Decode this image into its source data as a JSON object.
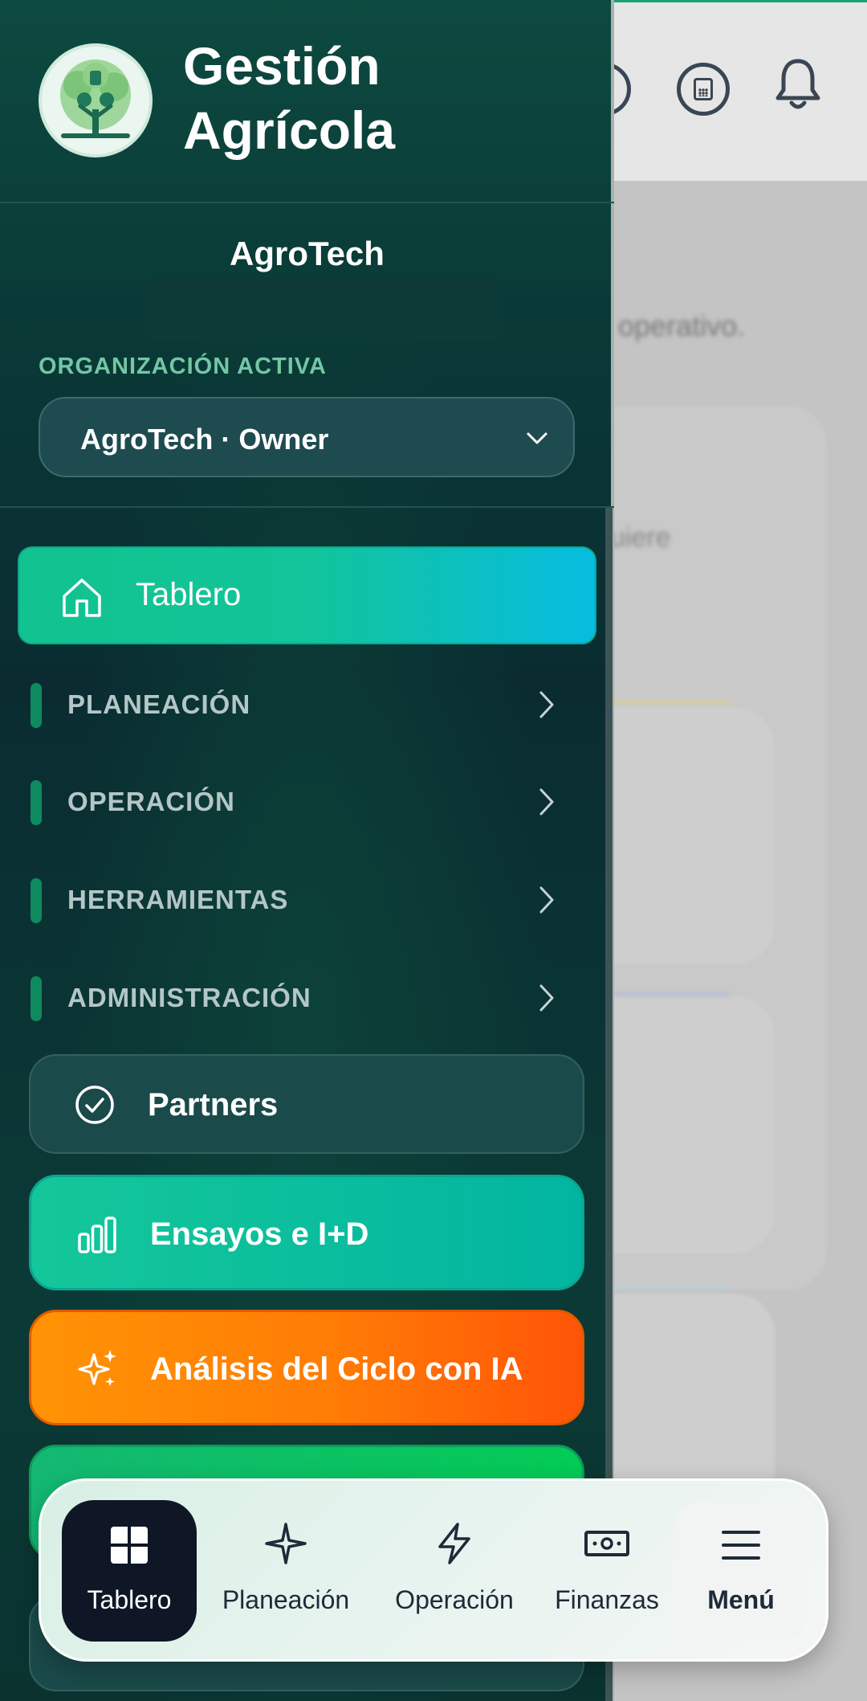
{
  "app": {
    "title_line1": "Gestión",
    "title_line2": "Agrícola"
  },
  "organization": {
    "name": "AgroTech",
    "label": "ORGANIZACIÓN ACTIVA",
    "selected": "AgroTech · Owner"
  },
  "nav": {
    "active": {
      "label": "Tablero",
      "icon": "home-icon"
    },
    "sections": [
      {
        "label": "PLANEACIÓN"
      },
      {
        "label": "OPERACIÓN"
      },
      {
        "label": "HERRAMIENTAS"
      },
      {
        "label": "ADMINISTRACIÓN"
      }
    ],
    "partners": {
      "label": "Partners",
      "icon": "check-circle-icon"
    },
    "ensayos": {
      "label": "Ensayos e I+D",
      "icon": "bar-chart-icon"
    },
    "ia": {
      "label": "Análisis del Ciclo con IA",
      "icon": "sparkles-icon"
    }
  },
  "background": {
    "text1": "o operativo.",
    "text2": "uiere"
  },
  "bottom_nav": {
    "items": [
      {
        "label": "Tablero",
        "icon": "grid-icon",
        "active": true
      },
      {
        "label": "Planeación",
        "icon": "sparkle-icon"
      },
      {
        "label": "Operación",
        "icon": "lightning-icon"
      },
      {
        "label": "Finanzas",
        "icon": "banknote-icon"
      },
      {
        "label": "Menú",
        "icon": "menu-icon"
      }
    ]
  },
  "colors": {
    "drawer_bg": "#0a2c31",
    "accent_teal": "#12c38f",
    "accent_cyan": "#07bce0",
    "accent_orange": "#ff7c05",
    "accent_green": "#03cb55",
    "label_green": "#74c6a4"
  }
}
